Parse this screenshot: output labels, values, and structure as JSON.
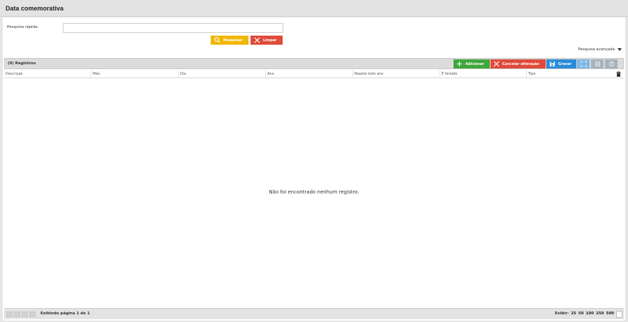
{
  "window": {
    "title": "Data comemorativa"
  },
  "search": {
    "label": "Pesquisa rápida:",
    "value": "",
    "placeholder": "",
    "search_button": "Pesquisar",
    "clear_button": "Limpar",
    "advanced_link": "Pesquisa avançada"
  },
  "grid": {
    "records_label": "(0) Registros",
    "toolbar": {
      "add": "Adicionar",
      "cancel": "Cancelar alteração",
      "save": "Gravar"
    },
    "columns": [
      "Descrição",
      "Mês",
      "Dia",
      "Ano",
      "Repete todo ano",
      "É feriado",
      "Tipo"
    ],
    "empty_message": "Não foi encontrado nenhum registro.",
    "footer": {
      "page_info": "Exibindo página 1 de 1",
      "show_label": "Exibir:",
      "page_sizes": [
        "25",
        "50",
        "100",
        "250",
        "500"
      ]
    }
  },
  "colors": {
    "search_button": "#f2b600",
    "clear_button": "#e04a3a",
    "add_button": "#3fa73a",
    "cancel_button": "#e04a3a",
    "save_button": "#2a8bd8"
  },
  "icons": [
    "search-icon",
    "close-icon",
    "plus-icon",
    "save-icon",
    "fullscreen-icon",
    "export-icon",
    "print-icon",
    "trash-icon",
    "lightbulb-icon"
  ]
}
